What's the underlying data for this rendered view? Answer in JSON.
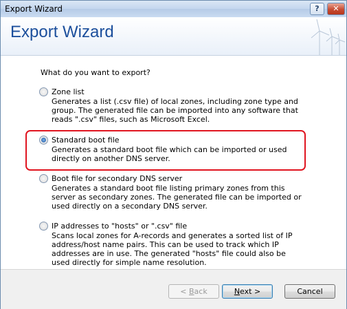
{
  "window": {
    "title": "Export Wizard",
    "help_glyph": "?",
    "close_glyph": "✕"
  },
  "header": {
    "title": "Export Wizard",
    "art_icon": "wind-turbines-icon"
  },
  "question": "What do you want to export?",
  "options": [
    {
      "label": "Zone list",
      "description": "Generates a list (.csv file) of local zones, including zone type and group. The generated file can be imported into any software that reads \".csv\" files, such as Microsoft Excel.",
      "selected": false
    },
    {
      "label": "Standard boot file",
      "description": "Generates a standard boot file which can be imported or used directly on another DNS server.",
      "selected": true
    },
    {
      "label": "Boot file for secondary DNS server",
      "description": "Generates a standard boot file listing primary zones from this server as secondary zones. The generated file can be imported or used directly on a secondary DNS server.",
      "selected": false
    },
    {
      "label": "IP addresses to \"hosts\" or \".csv\" file",
      "description": "Scans local zones for A-records and generates a sorted list of IP address/host name pairs. This can be used to track which IP addresses are in use. The generated \"hosts\" file could also be used directly for simple name resolution.",
      "selected": false
    }
  ],
  "buttons": {
    "back_mnemonic": "B",
    "back_rest": "ack",
    "back_prefix": "< ",
    "next_mnemonic": "N",
    "next_rest": "ext >",
    "cancel": "Cancel"
  },
  "colors": {
    "header_title": "#1c4f9c",
    "highlight": "#e0141f"
  }
}
